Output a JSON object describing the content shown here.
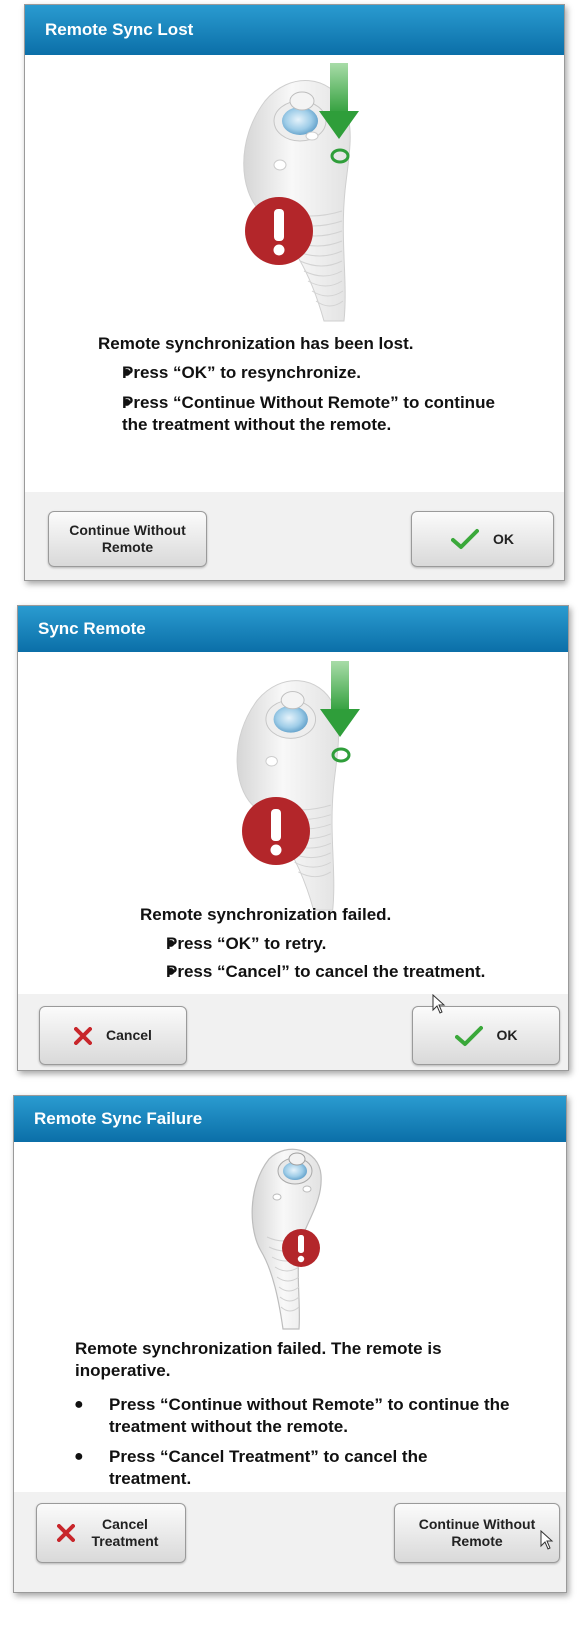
{
  "dialogs": [
    {
      "title": "Remote Sync Lost",
      "message": "Remote synchronization has been lost.",
      "bullets": [
        "Press “OK” to resynchronize.",
        "Press “Continue Without Remote” to continue the treatment without the remote."
      ],
      "buttons": {
        "left": "Continue Without Remote",
        "right": "OK"
      }
    },
    {
      "title": "Sync Remote",
      "message": "Remote synchronization failed.",
      "bullets": [
        "Press “OK” to retry.",
        "Press “Cancel” to cancel the treatment."
      ],
      "buttons": {
        "left": "Cancel",
        "right": "OK"
      }
    },
    {
      "title": "Remote Sync Failure",
      "message": "Remote synchronization failed.  The remote is inoperative.",
      "bullets": [
        "Press “Continue without Remote” to continue the treatment without the remote.",
        "Press “Cancel Treatment” to cancel the treatment."
      ],
      "buttons": {
        "left": "Cancel Treatment",
        "right": "Continue Without Remote"
      }
    }
  ],
  "colors": {
    "title_bar": "#1683bd",
    "alert_red": "#b3262a",
    "check_green": "#3aa83a",
    "cancel_red": "#c8262b",
    "arrow_green": "#2f9e3a"
  },
  "icons": [
    "remote-device-icon",
    "alert-icon",
    "down-arrow-icon",
    "check-icon",
    "x-icon",
    "mouse-pointer-icon"
  ]
}
